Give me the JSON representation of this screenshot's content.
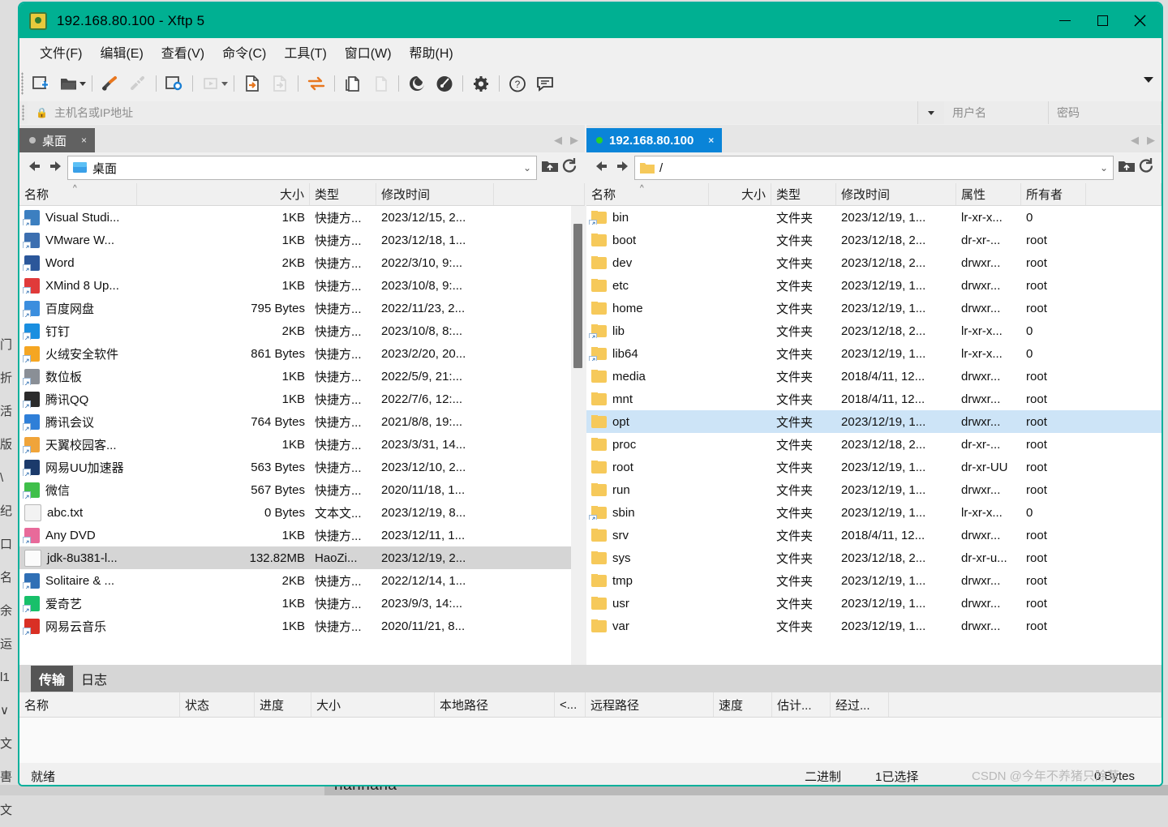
{
  "window": {
    "title": "192.168.80.100    - Xftp 5",
    "logo_icon": "xftp-logo-icon",
    "minimize_label": "—",
    "maximize_label": "□",
    "close_label": "✕"
  },
  "menubar": {
    "items": [
      {
        "label": "文件(F)",
        "name": "menu-file"
      },
      {
        "label": "编辑(E)",
        "name": "menu-edit"
      },
      {
        "label": "查看(V)",
        "name": "menu-view"
      },
      {
        "label": "命令(C)",
        "name": "menu-command"
      },
      {
        "label": "工具(T)",
        "name": "menu-tools"
      },
      {
        "label": "窗口(W)",
        "name": "menu-window"
      },
      {
        "label": "帮助(H)",
        "name": "menu-help"
      }
    ]
  },
  "toolbar": {
    "buttons": [
      {
        "name": "new-session-icon"
      },
      {
        "name": "open-folder-icon"
      },
      {
        "name": "new-file-transfer-icon"
      },
      {
        "name": "disconnect-icon"
      },
      {
        "name": "session-properties-icon"
      },
      {
        "name": "run-icon"
      },
      {
        "name": "transfer-file-icon"
      },
      {
        "name": "transfer-file-disabled-icon"
      },
      {
        "name": "sync-browsing-icon"
      },
      {
        "name": "copy-icon"
      },
      {
        "name": "paste-disabled-icon"
      },
      {
        "name": "xshell-icon"
      },
      {
        "name": "xftp-link-icon"
      },
      {
        "name": "options-gear-icon"
      },
      {
        "name": "help-icon"
      },
      {
        "name": "feedback-icon"
      }
    ],
    "overflow_icon": "toolbar-overflow-icon"
  },
  "hostbar": {
    "host_placeholder": "主机名或IP地址",
    "user_placeholder": "用户名",
    "password_placeholder": "密码",
    "lock_icon": "lock-icon",
    "dropdown_icon": "chevron-down-icon"
  },
  "local_pane": {
    "tab_label": "桌面",
    "tab_close": "×",
    "path": "桌面",
    "path_icon": "desktop-icon",
    "back_icon": "back-arrow-icon",
    "forward_icon": "forward-arrow-icon",
    "up_icon": "parent-folder-icon",
    "refresh_icon": "refresh-icon",
    "columns": [
      "名称",
      "大小",
      "类型",
      "修改时间"
    ],
    "sort_indicator": "^",
    "rows": [
      {
        "name": "Visual Studi...",
        "size": "1KB",
        "type": "快捷方...",
        "mtime": "2023/12/15, 2...",
        "icon": "visual-studio-icon",
        "color": "#3c7fc0",
        "shortcut": true,
        "selected": false
      },
      {
        "name": "VMware W...",
        "size": "1KB",
        "type": "快捷方...",
        "mtime": "2023/12/18, 1...",
        "icon": "vmware-icon",
        "color": "#3c6fb0",
        "shortcut": true,
        "selected": false
      },
      {
        "name": "Word",
        "size": "2KB",
        "type": "快捷方...",
        "mtime": "2022/3/10, 9:...",
        "icon": "word-icon",
        "color": "#2b579a",
        "shortcut": true,
        "selected": false
      },
      {
        "name": "XMind 8 Up...",
        "size": "1KB",
        "type": "快捷方...",
        "mtime": "2023/10/8, 9:...",
        "icon": "xmind-icon",
        "color": "#e03a3a",
        "shortcut": true,
        "selected": false
      },
      {
        "name": "百度网盘",
        "size": "795 Bytes",
        "type": "快捷方...",
        "mtime": "2022/11/23, 2...",
        "icon": "baidu-netdisk-icon",
        "color": "#3b8ede",
        "shortcut": true,
        "selected": false
      },
      {
        "name": "钉钉",
        "size": "2KB",
        "type": "快捷方...",
        "mtime": "2023/10/8, 8:...",
        "icon": "dingtalk-icon",
        "color": "#1a8fe0",
        "shortcut": true,
        "selected": false
      },
      {
        "name": "火绒安全软件",
        "size": "861 Bytes",
        "type": "快捷方...",
        "mtime": "2023/2/20, 20...",
        "icon": "huorong-icon",
        "color": "#f5a623",
        "shortcut": true,
        "selected": false
      },
      {
        "name": "数位板",
        "size": "1KB",
        "type": "快捷方...",
        "mtime": "2022/5/9, 21:...",
        "icon": "tablet-icon",
        "color": "#8a8f96",
        "shortcut": true,
        "selected": false
      },
      {
        "name": "腾讯QQ",
        "size": "1KB",
        "type": "快捷方...",
        "mtime": "2022/7/6, 12:...",
        "icon": "qq-icon",
        "color": "#2b2b2b",
        "shortcut": true,
        "selected": false
      },
      {
        "name": "腾讯会议",
        "size": "764 Bytes",
        "type": "快捷方...",
        "mtime": "2021/8/8, 19:...",
        "icon": "tencent-meeting-icon",
        "color": "#2f7fd8",
        "shortcut": true,
        "selected": false
      },
      {
        "name": "天翼校园客...",
        "size": "1KB",
        "type": "快捷方...",
        "mtime": "2023/3/31, 14...",
        "icon": "tianyi-campus-icon",
        "color": "#f0a43a",
        "shortcut": true,
        "selected": false
      },
      {
        "name": "网易UU加速器",
        "size": "563 Bytes",
        "type": "快捷方...",
        "mtime": "2023/12/10, 2...",
        "icon": "uu-booster-icon",
        "color": "#1b3a6b",
        "shortcut": true,
        "selected": false
      },
      {
        "name": "微信",
        "size": "567 Bytes",
        "type": "快捷方...",
        "mtime": "2020/11/18, 1...",
        "icon": "wechat-icon",
        "color": "#3fbf4a",
        "shortcut": true,
        "selected": false
      },
      {
        "name": "abc.txt",
        "size": "0 Bytes",
        "type": "文本文...",
        "mtime": "2023/12/19, 8...",
        "icon": "text-file-icon",
        "color": "#f2f2f2",
        "shortcut": false,
        "selected": false
      },
      {
        "name": "Any DVD",
        "size": "1KB",
        "type": "快捷方...",
        "mtime": "2023/12/11, 1...",
        "icon": "any-dvd-icon",
        "color": "#e86a9a",
        "shortcut": true,
        "selected": false
      },
      {
        "name": "jdk-8u381-l...",
        "size": "132.82MB",
        "type": "HaoZi...",
        "mtime": "2023/12/19, 2...",
        "icon": "generic-file-icon",
        "color": "#fbfbfb",
        "shortcut": false,
        "selected": true
      },
      {
        "name": "Solitaire & ...",
        "size": "2KB",
        "type": "快捷方...",
        "mtime": "2022/12/14, 1...",
        "icon": "solitaire-icon",
        "color": "#2f6fb5",
        "shortcut": true,
        "selected": false
      },
      {
        "name": "爱奇艺",
        "size": "1KB",
        "type": "快捷方...",
        "mtime": "2023/9/3, 14:...",
        "icon": "iqiyi-icon",
        "color": "#18c06a",
        "shortcut": true,
        "selected": false
      },
      {
        "name": "网易云音乐",
        "size": "1KB",
        "type": "快捷方...",
        "mtime": "2020/11/21, 8...",
        "icon": "netease-music-icon",
        "color": "#d93025",
        "shortcut": true,
        "selected": false
      }
    ]
  },
  "remote_pane": {
    "tab_label": "192.168.80.100",
    "tab_close": "×",
    "path": "/",
    "path_icon": "folder-icon",
    "back_icon": "back-arrow-icon",
    "forward_icon": "forward-arrow-icon",
    "up_icon": "parent-folder-icon",
    "refresh_icon": "refresh-icon",
    "columns": [
      "名称",
      "大小",
      "类型",
      "修改时间",
      "属性",
      "所有者"
    ],
    "sort_indicator": "^",
    "rows": [
      {
        "name": "bin",
        "size": "",
        "type": "文件夹",
        "mtime": "2023/12/19, 1...",
        "attr": "lr-xr-x...",
        "owner": "0",
        "link": true,
        "selected": false
      },
      {
        "name": "boot",
        "size": "",
        "type": "文件夹",
        "mtime": "2023/12/18, 2...",
        "attr": "dr-xr-...",
        "owner": "root",
        "link": false,
        "selected": false
      },
      {
        "name": "dev",
        "size": "",
        "type": "文件夹",
        "mtime": "2023/12/18, 2...",
        "attr": "drwxr...",
        "owner": "root",
        "link": false,
        "selected": false
      },
      {
        "name": "etc",
        "size": "",
        "type": "文件夹",
        "mtime": "2023/12/19, 1...",
        "attr": "drwxr...",
        "owner": "root",
        "link": false,
        "selected": false
      },
      {
        "name": "home",
        "size": "",
        "type": "文件夹",
        "mtime": "2023/12/19, 1...",
        "attr": "drwxr...",
        "owner": "root",
        "link": false,
        "selected": false
      },
      {
        "name": "lib",
        "size": "",
        "type": "文件夹",
        "mtime": "2023/12/18, 2...",
        "attr": "lr-xr-x...",
        "owner": "0",
        "link": true,
        "selected": false
      },
      {
        "name": "lib64",
        "size": "",
        "type": "文件夹",
        "mtime": "2023/12/19, 1...",
        "attr": "lr-xr-x...",
        "owner": "0",
        "link": true,
        "selected": false
      },
      {
        "name": "media",
        "size": "",
        "type": "文件夹",
        "mtime": "2018/4/11, 12...",
        "attr": "drwxr...",
        "owner": "root",
        "link": false,
        "selected": false
      },
      {
        "name": "mnt",
        "size": "",
        "type": "文件夹",
        "mtime": "2018/4/11, 12...",
        "attr": "drwxr...",
        "owner": "root",
        "link": false,
        "selected": false
      },
      {
        "name": "opt",
        "size": "",
        "type": "文件夹",
        "mtime": "2023/12/19, 1...",
        "attr": "drwxr...",
        "owner": "root",
        "link": false,
        "selected": true
      },
      {
        "name": "proc",
        "size": "",
        "type": "文件夹",
        "mtime": "2023/12/18, 2...",
        "attr": "dr-xr-...",
        "owner": "root",
        "link": false,
        "selected": false
      },
      {
        "name": "root",
        "size": "",
        "type": "文件夹",
        "mtime": "2023/12/19, 1...",
        "attr": "dr-xr-UU",
        "owner": "root",
        "link": false,
        "selected": false
      },
      {
        "name": "run",
        "size": "",
        "type": "文件夹",
        "mtime": "2023/12/19, 1...",
        "attr": "drwxr...",
        "owner": "root",
        "link": false,
        "selected": false
      },
      {
        "name": "sbin",
        "size": "",
        "type": "文件夹",
        "mtime": "2023/12/19, 1...",
        "attr": "lr-xr-x...",
        "owner": "0",
        "link": true,
        "selected": false
      },
      {
        "name": "srv",
        "size": "",
        "type": "文件夹",
        "mtime": "2018/4/11, 12...",
        "attr": "drwxr...",
        "owner": "root",
        "link": false,
        "selected": false
      },
      {
        "name": "sys",
        "size": "",
        "type": "文件夹",
        "mtime": "2023/12/18, 2...",
        "attr": "dr-xr-u...",
        "owner": "root",
        "link": false,
        "selected": false
      },
      {
        "name": "tmp",
        "size": "",
        "type": "文件夹",
        "mtime": "2023/12/19, 1...",
        "attr": "drwxr...",
        "owner": "root",
        "link": false,
        "selected": false
      },
      {
        "name": "usr",
        "size": "",
        "type": "文件夹",
        "mtime": "2023/12/19, 1...",
        "attr": "drwxr...",
        "owner": "root",
        "link": false,
        "selected": false
      },
      {
        "name": "var",
        "size": "",
        "type": "文件夹",
        "mtime": "2023/12/19, 1...",
        "attr": "drwxr...",
        "owner": "root",
        "link": false,
        "selected": false
      }
    ]
  },
  "transfer_panel": {
    "tabs": [
      {
        "label": "传输",
        "active": true,
        "name": "tab-transfer"
      },
      {
        "label": "日志",
        "active": false,
        "name": "tab-log"
      }
    ],
    "columns": [
      "名称",
      "状态",
      "进度",
      "大小",
      "本地路径",
      "<...",
      "远程路径",
      "速度",
      "估计...",
      "经过..."
    ],
    "rows": []
  },
  "statusbar": {
    "status": "就绪",
    "transfer_mode": "二进制",
    "selection": "1已选择",
    "size": "0 Bytes"
  },
  "watermark": "CSDN @今年不养猪只除草",
  "background": {
    "bottom_text": "hannana",
    "left_column": [
      "门",
      "折",
      "活",
      "版",
      "\\",
      "纪",
      "口",
      "名",
      "余",
      "运",
      "l1",
      "∨",
      "文",
      "軎",
      "文"
    ]
  }
}
